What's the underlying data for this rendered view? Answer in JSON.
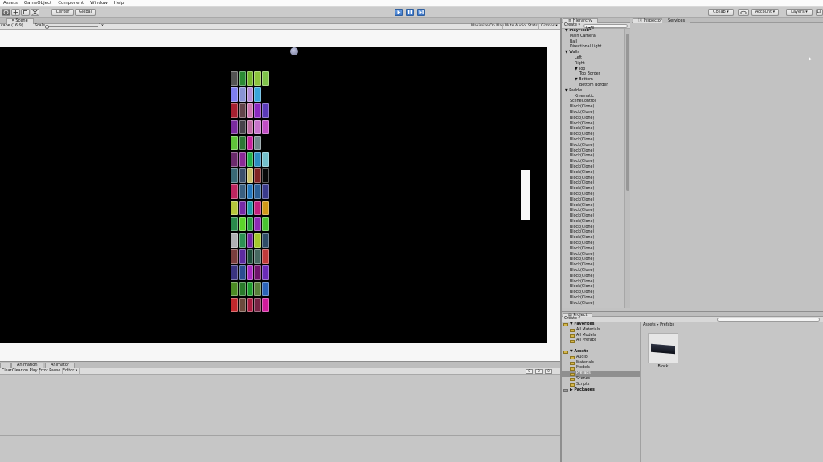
{
  "menu": [
    "Assets",
    "GameObject",
    "Component",
    "Window",
    "Help"
  ],
  "toolbar": {
    "pivot": "Center",
    "space": "Global",
    "collab": "Collab ▾",
    "account": "Account ▾",
    "layers": "Layers ▾",
    "layout": "La"
  },
  "tabs": {
    "scene": "Scene",
    "hierarchy": "Hierarchy",
    "inspector": "Inspector",
    "services": "Services",
    "project": "Project",
    "animation": "Animation",
    "animator": "Animator"
  },
  "game": {
    "aspect": "cape (16:9)",
    "scale_label": "Scale",
    "scale_value": "1x",
    "maximize": "Maximize On Play",
    "mute": "Mute Audio",
    "stats": "Stats",
    "gizmos": "Gizmos ▾"
  },
  "console": {
    "buttons": [
      "Clear",
      "Clear on Play",
      "Error Pause",
      "Editor ▾"
    ],
    "counts": [
      "0",
      "0",
      "0"
    ]
  },
  "hierarchy": {
    "create": "Create ▾",
    "search_placeholder": "Q▾All",
    "items": [
      {
        "label": "▼ PlayField*",
        "indent": 0,
        "bold": true
      },
      {
        "label": "Main Camera",
        "indent": 1
      },
      {
        "label": "Ball",
        "indent": 1
      },
      {
        "label": "Directional Light",
        "indent": 1
      },
      {
        "label": "▼ Walls",
        "indent": 0
      },
      {
        "label": "Left",
        "indent": 2
      },
      {
        "label": "Right",
        "indent": 2
      },
      {
        "label": "▼ Top",
        "indent": 2
      },
      {
        "label": "Top Border",
        "indent": 3
      },
      {
        "label": "▼ Bottom",
        "indent": 2
      },
      {
        "label": "Bottom Border",
        "indent": 3
      },
      {
        "label": "▼ Paddle",
        "indent": 0
      },
      {
        "label": "Kinematic",
        "indent": 2
      },
      {
        "label": "SceneControl",
        "indent": 1
      },
      {
        "label": "Block(Clone)",
        "indent": 1
      },
      {
        "label": "Block(Clone)",
        "indent": 1
      },
      {
        "label": "Block(Clone)",
        "indent": 1
      },
      {
        "label": "Block(Clone)",
        "indent": 1
      },
      {
        "label": "Block(Clone)",
        "indent": 1
      },
      {
        "label": "Block(Clone)",
        "indent": 1
      },
      {
        "label": "Block(Clone)",
        "indent": 1
      },
      {
        "label": "Block(Clone)",
        "indent": 1
      },
      {
        "label": "Block(Clone)",
        "indent": 1
      },
      {
        "label": "Block(Clone)",
        "indent": 1
      },
      {
        "label": "Block(Clone)",
        "indent": 1
      },
      {
        "label": "Block(Clone)",
        "indent": 1
      },
      {
        "label": "Block(Clone)",
        "indent": 1
      },
      {
        "label": "Block(Clone)",
        "indent": 1
      },
      {
        "label": "Block(Clone)",
        "indent": 1
      },
      {
        "label": "Block(Clone)",
        "indent": 1
      },
      {
        "label": "Block(Clone)",
        "indent": 1
      },
      {
        "label": "Block(Clone)",
        "indent": 1
      },
      {
        "label": "Block(Clone)",
        "indent": 1
      },
      {
        "label": "Block(Clone)",
        "indent": 1
      },
      {
        "label": "Block(Clone)",
        "indent": 1
      },
      {
        "label": "Block(Clone)",
        "indent": 1
      },
      {
        "label": "Block(Clone)",
        "indent": 1
      },
      {
        "label": "Block(Clone)",
        "indent": 1
      },
      {
        "label": "Block(Clone)",
        "indent": 1
      },
      {
        "label": "Block(Clone)",
        "indent": 1
      },
      {
        "label": "Block(Clone)",
        "indent": 1
      },
      {
        "label": "Block(Clone)",
        "indent": 1
      },
      {
        "label": "Block(Clone)",
        "indent": 1
      },
      {
        "label": "Block(Clone)",
        "indent": 1
      },
      {
        "label": "Block(Clone)",
        "indent": 1
      },
      {
        "label": "Block(Clone)",
        "indent": 1
      },
      {
        "label": "Block(Clone)",
        "indent": 1
      },
      {
        "label": "Block(Clone)",
        "indent": 1
      },
      {
        "label": "Block(Clone)",
        "indent": 1
      },
      {
        "label": "Block(Clone)",
        "indent": 1
      },
      {
        "label": "Block(Clone)",
        "indent": 1
      }
    ]
  },
  "project": {
    "create": "Create ▾",
    "tree": [
      {
        "label": "▼ Favorites",
        "indent": 0,
        "bold": true,
        "icon": "star"
      },
      {
        "label": "All Materials",
        "indent": 2,
        "icon": "search"
      },
      {
        "label": "All Models",
        "indent": 2,
        "icon": "search"
      },
      {
        "label": "All Prefabs",
        "indent": 2,
        "icon": "search"
      },
      {
        "label": "",
        "indent": 0,
        "icon": "none"
      },
      {
        "label": "▼ Assets",
        "indent": 0,
        "bold": true,
        "icon": "folder"
      },
      {
        "label": "Audio",
        "indent": 2,
        "icon": "folder"
      },
      {
        "label": "Materials",
        "indent": 2,
        "icon": "folder"
      },
      {
        "label": "Models",
        "indent": 2,
        "icon": "folder"
      },
      {
        "label": "Prefabs",
        "indent": 2,
        "icon": "folder",
        "selected": true
      },
      {
        "label": "Scenes",
        "indent": 2,
        "icon": "folder"
      },
      {
        "label": "Scripts",
        "indent": 2,
        "icon": "folder"
      },
      {
        "label": "▶ Packages",
        "indent": 0,
        "bold": true,
        "icon": "folder-grey"
      }
    ],
    "breadcrumb": "Assets ▸ Prefabs",
    "asset_name": "Block"
  },
  "blocks": {
    "rows": [
      [
        "#545454",
        "#2b8a33",
        "#74b52c",
        "#8cc33c",
        "#7ec24a"
      ],
      [
        "#7f7ff0",
        "#8a94d4",
        "#b78fd8",
        "#3aa6d9",
        ""
      ],
      [
        "#a62030",
        "#62444a",
        "#d079b1",
        "#8b29c0",
        "#5a3ab8"
      ],
      [
        "#7a2b9e",
        "#47434a",
        "#c06ca4",
        "#c774cb",
        "#c04ec4"
      ],
      [
        "#5fc43a",
        "#2c7534",
        "#c7209c",
        "#72888c",
        ""
      ],
      [
        "#6a2a6c",
        "#8a2a96",
        "#22b048",
        "#2c8cc0",
        "#74c0cc"
      ],
      [
        "#3a6a76",
        "#3c506c",
        "#ccc26a",
        "#802424",
        "#080808"
      ],
      [
        "#be2660",
        "#3a5f80",
        "#2276bc",
        "#2c6096",
        "#3a3a8c"
      ],
      [
        "#b6c73c",
        "#762aa6",
        "#209ca8",
        "#c2207c",
        "#d09818"
      ],
      [
        "#2a8a4c",
        "#5cd42a",
        "#28a03c",
        "#8c2ab4",
        "#4ac230"
      ],
      [
        "#b0b0b4",
        "#2c9052",
        "#7424a4",
        "#a4c82c",
        "#2e4c66"
      ],
      [
        "#7a3e3e",
        "#5c2aa0",
        "#1c4c38",
        "#466860",
        "#c03a3a"
      ],
      [
        "#3a3480",
        "#2c4c90",
        "#a828c0",
        "#70146c",
        "#6a2ab8"
      ],
      [
        "#4c8c24",
        "#2a7a2a",
        "#1e9c2c",
        "#58803a",
        "#2c64b8"
      ],
      [
        "#c0282c",
        "#6c4a3c",
        "#aa1c40",
        "#762444",
        "#d01c9c"
      ]
    ]
  }
}
